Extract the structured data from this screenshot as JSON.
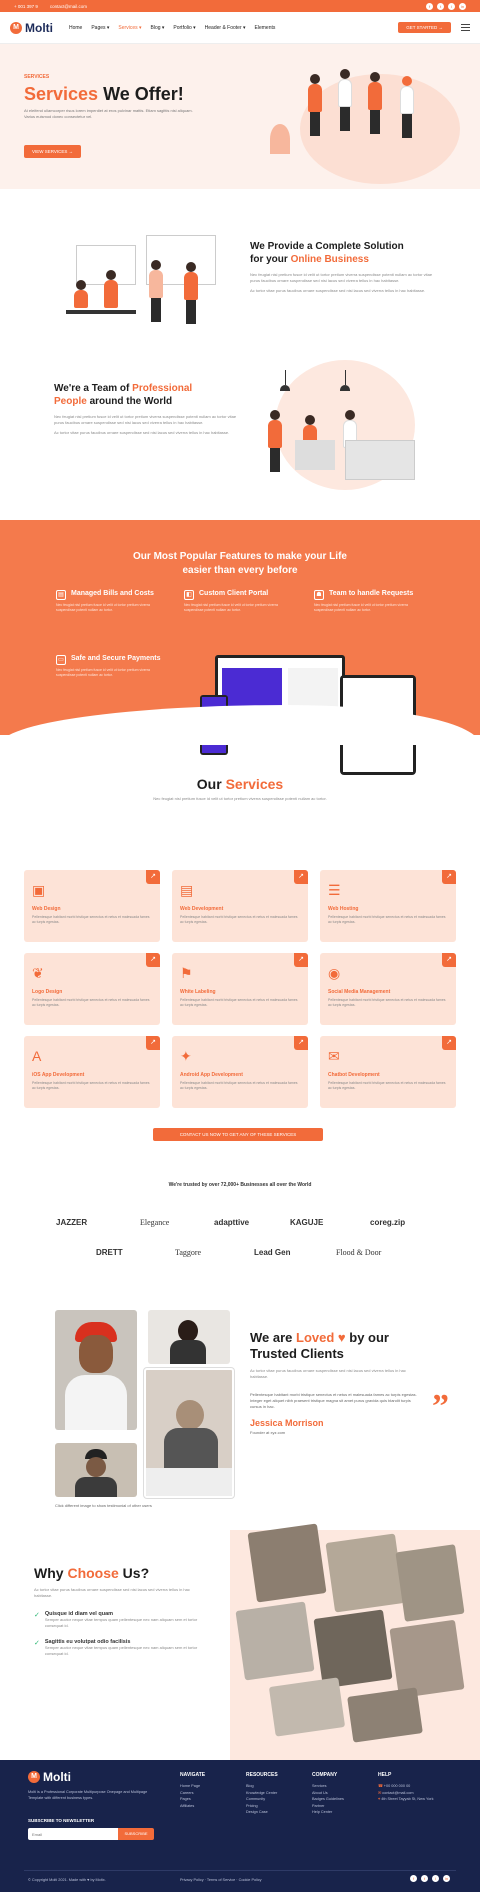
{
  "topbar": {
    "phone": "+ 001 397 9",
    "email": "contact@mail.com"
  },
  "nav": {
    "logo": "Molti",
    "items": [
      "Home",
      "Pages ▾",
      "Services ▾",
      "Blog ▾",
      "Portfolio ▾",
      "Header & Footer ▾",
      "Elements"
    ],
    "cta": "GET STARTED →"
  },
  "hero": {
    "tag": "SERVICES",
    "title_accent": "Services",
    "title_rest": " We Offer!",
    "subtitle": "At eleifend ullamcorper risus lorem imperdiet at eros pulvinar mattis. Etiam sagittis nisl aliquam. Varius euismod donec consectetur vel.",
    "button": "VIEW SERVICES →"
  },
  "solution": {
    "title_1": "We Provide a Complete Solution",
    "title_2_pre": "for your ",
    "title_2_accent": "Online Business",
    "para1": "Nec feugiat nisl pretium fusce id velit ut tortor pretium viverra suspendisse potenti nullam ac tortor vitae purus faucibus ornare suspendisse sed nisi lacus sed viverra tellus in hac habitasse.",
    "para2": "Ac tortor vitae purus faucibus ornare suspendisse sed nisi lacus sed viverra tellus in hac habitasse."
  },
  "team": {
    "title_1": "We're a Team of ",
    "title_accent": "Professional",
    "title_2_accent": "People",
    "title_2_rest": " around the World",
    "para1": "Nec feugiat nisl pretium fusce id velit ut tortor pretium viverra suspendisse potenti nullam ac tortor vitae purus faucibus ornare suspendisse sed nisi lacus sed viverra tellus in hac habitasse.",
    "para2": "Ac tortor vitae purus faucibus ornare suspendisse sed nisi lacus sed viverra tellus in hac habitasse."
  },
  "features": {
    "title_1": "Our Most Popular Features to make your Life",
    "title_2": "easier than every before",
    "items": [
      {
        "title": "Managed Bills and Costs",
        "desc": "Nec feugiat nisl pretium fusce id velit ut tortor pretium viverra suspendisse potenti nullam ac tortor."
      },
      {
        "title": "Custom Client Portal",
        "desc": "Nec feugiat nisl pretium fusce id velit ut tortor pretium viverra suspendisse potenti nullam ac tortor."
      },
      {
        "title": "Team to handle Requests",
        "desc": "Nec feugiat nisl pretium fusce id velit ut tortor pretium viverra suspendisse potenti nullam ac tortor."
      },
      {
        "title": "Safe and Secure Payments",
        "desc": "Nec feugiat nisl pretium fusce id velit ut tortor pretium viverra suspendisse potenti nullam ac tortor."
      }
    ]
  },
  "services": {
    "title_1": "Our ",
    "title_accent": "Services",
    "subtitle": "Nec feugiat nisl pretium fusce id velit ut tortor pretium viverra suspendisse potenti nullam ac tortor.",
    "cards": [
      {
        "icon": "▣",
        "name": "Web Design",
        "desc": "Pellentesque habitant morbi tristique senectus et netus et malesuada fames ac turpis egestas."
      },
      {
        "icon": "▤",
        "name": "Web Development",
        "desc": "Pellentesque habitant morbi tristique senectus et netus et malesuada fames ac turpis egestas."
      },
      {
        "icon": "☰",
        "name": "Web Hosting",
        "desc": "Pellentesque habitant morbi tristique senectus et netus et malesuada fames ac turpis egestas."
      },
      {
        "icon": "❦",
        "name": "Logo Design",
        "desc": "Pellentesque habitant morbi tristique senectus et netus et malesuada fames ac turpis egestas."
      },
      {
        "icon": "⚑",
        "name": "White Labeling",
        "desc": "Pellentesque habitant morbi tristique senectus et netus et malesuada fames ac turpis egestas."
      },
      {
        "icon": "◉",
        "name": "Social Media Management",
        "desc": "Pellentesque habitant morbi tristique senectus et netus et malesuada fames ac turpis egestas."
      },
      {
        "icon": "A",
        "name": "iOS App Development",
        "desc": "Pellentesque habitant morbi tristique senectus et netus et malesuada fames ac turpis egestas."
      },
      {
        "icon": "✦",
        "name": "Android App Development",
        "desc": "Pellentesque habitant morbi tristique senectus et netus et malesuada fames ac turpis egestas."
      },
      {
        "icon": "✉",
        "name": "Chatbot Development",
        "desc": "Pellentesque habitant morbi tristique senectus et netus et malesuada fames ac turpis egestas."
      }
    ],
    "button": "CONTACT US NOW TO GET ANY OF THESE SERVICES"
  },
  "trusted": {
    "title": "We're trusted by over 72,000+ Businesses all over the World",
    "brands": [
      "JAZZER",
      "Elegance",
      "adapttive",
      "KAGUJE",
      "coreg.zip",
      "DRETT",
      "Taggore",
      "Lead Gen",
      "Flood & Door"
    ]
  },
  "testimonial": {
    "title_1": "We are ",
    "title_accent": "Loved ♥",
    "title_rest": " by our",
    "title_2": "Trusted Clients",
    "para": "Ac tortor vitae purus faucibus ornare suspendisse sed nisi lacus sed viverra tellus in hac habitasse.",
    "quote": "Pellentesque habitant morbi tristique senectus et netus et malesuada fames ac turpis egestas. Integer eget aliquet nibh praesent tristique magna sit amet purus gravida quis blandit turpis cursus in hac.",
    "name": "Jessica Morrison",
    "role": "Founder at xyz.com",
    "caption": "Click different image to show testimonial of other users"
  },
  "why": {
    "title_1": "Why ",
    "title_accent": "Choose",
    "title_rest": " Us?",
    "para": "Ac tortor vitae purus faucibus ornare suspendisse sed nisi lacus sed viverra tellus in hac habitasse.",
    "points": [
      {
        "title": "Quisque id diam vel quam",
        "desc": "Semper auctor neque vitae tempus quam pellentesque nec nam aliquam sem et tortor consequat id."
      },
      {
        "title": "Sagittis eu volutpat odio facilisis",
        "desc": "Semper auctor neque vitae tempus quam pellentesque nec nam aliquam sem et tortor consequat id."
      }
    ]
  },
  "footer": {
    "logo": "Molti",
    "about": "Molti is a Professional Corporate Multipurpose Onepage and Multipage Template with different business types.",
    "newsletter_title": "SUBSCRIBE TO NEWSLETTER",
    "email_placeholder": "Email",
    "subscribe": "SUBSCRIBE",
    "cols": [
      {
        "title": "NAVIGATE",
        "links": [
          "Home Page",
          "Careers",
          "Pages",
          "Affiliates"
        ]
      },
      {
        "title": "RESOURCES",
        "links": [
          "Blog",
          "Knowledge Center",
          "Community",
          "Pricing",
          "Design Case"
        ]
      },
      {
        "title": "COMPANY",
        "links": [
          "Services",
          "About Us",
          "Badges Guidelines",
          "Partner",
          "Help Center"
        ]
      },
      {
        "title": "HELP",
        "links": [
          "+00 000 000 00",
          "contact@mail.com",
          "4th Street Tayyab St, New York"
        ]
      }
    ],
    "copyright": "© Copyright Molti 2021. Made with ♥ by Moltx.",
    "legal": "Privacy Policy · Terms of Service · Cookie Policy"
  },
  "colors": {
    "accent": "#f26b3a",
    "navy": "#18234b",
    "peach": "#fde3d7"
  }
}
